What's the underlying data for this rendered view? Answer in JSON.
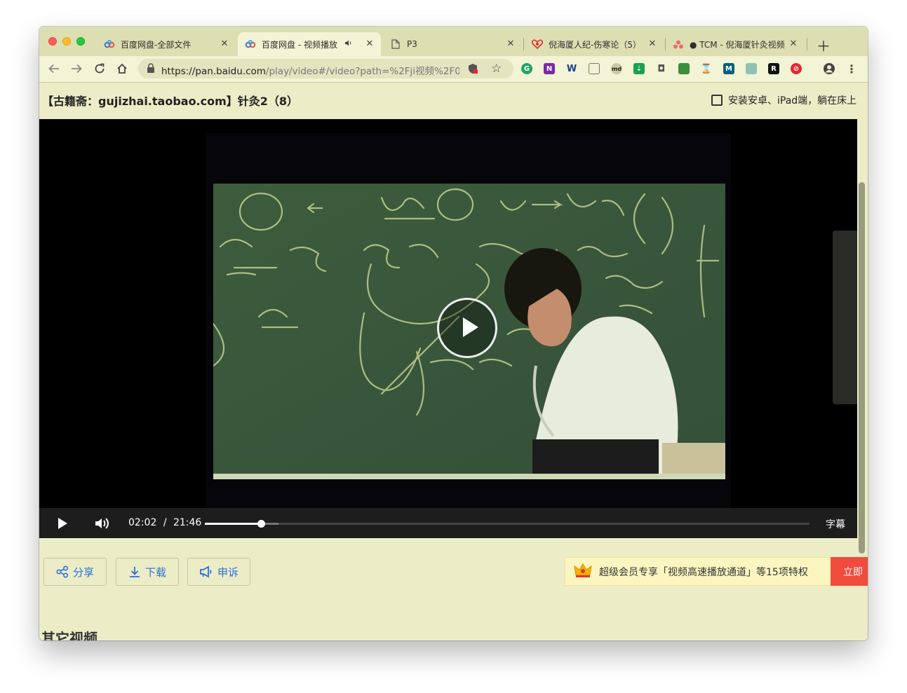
{
  "browser": {
    "tabs": [
      {
        "title": "百度网盘-全部文件",
        "active": false
      },
      {
        "title": "百度网盘 - 视频播放",
        "active": true
      },
      {
        "title": "P3",
        "active": false
      },
      {
        "title": "倪海厦人纪-伤寒论（5）",
        "active": false
      },
      {
        "title": "● TCM - 倪海厦针灸视频",
        "active": false
      }
    ],
    "url_host": "https://pan.baidu.com",
    "url_path": "/play/video#/video?path=%2Fji视频%2F0..."
  },
  "page": {
    "video_title": "【古籍斋：gujizhai.taobao.com】针灸2（8）",
    "checkbox_label": "安装安卓、iPad端，躺在床上"
  },
  "player": {
    "current_time": "02:02",
    "separator": "/",
    "duration": "21:46",
    "progress_played_fraction": 0.093,
    "progress_buffered_fraction": 0.122,
    "subtitle_label": "字幕"
  },
  "actions": {
    "share": "分享",
    "download": "下载",
    "report": "申诉"
  },
  "promo": {
    "text": "超级会员专享「视频高速播放通道」等15项特权",
    "cta": "立即"
  },
  "section": {
    "other_videos": "其它视频"
  },
  "colors": {
    "link_blue": "#2a6fd8",
    "promo_red": "#f04b3c",
    "page_bg": "#ececc7"
  }
}
